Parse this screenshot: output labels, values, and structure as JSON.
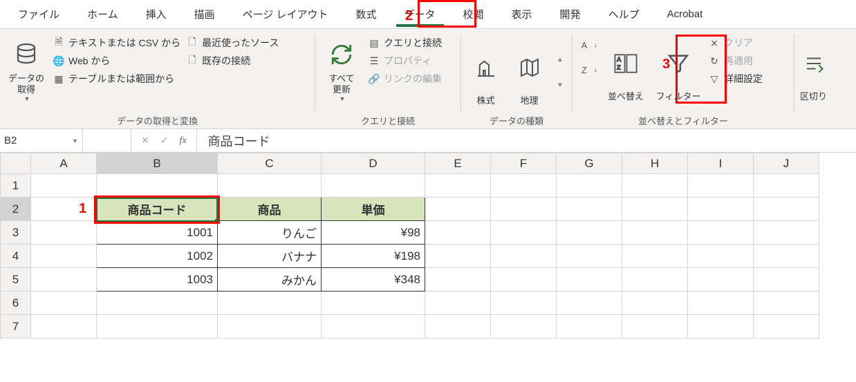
{
  "tabs": {
    "file": "ファイル",
    "home": "ホーム",
    "insert": "挿入",
    "draw": "描画",
    "pagelayout": "ページ レイアウト",
    "formulas": "数式",
    "data": "データ",
    "review": "校閲",
    "view": "表示",
    "developer": "開発",
    "help": "ヘルプ",
    "acrobat": "Acrobat"
  },
  "ribbon": {
    "group1": {
      "getdata": "データの\n取得",
      "from_csv": "テキストまたは CSV から",
      "from_web": "Web から",
      "from_table": "テーブルまたは範囲から",
      "recent": "最近使ったソース",
      "existing": "既存の接続",
      "label": "データの取得と変換"
    },
    "group2": {
      "refresh": "すべて\n更新",
      "queries": "クエリと接続",
      "properties": "プロパティ",
      "editlinks": "リンクの編集",
      "label": "クエリと接続"
    },
    "group3": {
      "stocks": "株式",
      "geo": "地理",
      "label": "データの種類"
    },
    "group4": {
      "sort": "並べ替え",
      "filter": "フィルター",
      "clear": "クリア",
      "reapply": "再適用",
      "advanced": "詳細設定",
      "label": "並べ替えとフィルター"
    },
    "group5": {
      "texttocol": "区切り"
    }
  },
  "fx": {
    "namebox": "B2",
    "formula": "商品コード"
  },
  "columns": [
    "A",
    "B",
    "C",
    "D",
    "E",
    "F",
    "G",
    "H",
    "I",
    "J"
  ],
  "rows": [
    "1",
    "2",
    "3",
    "4",
    "5",
    "6",
    "7"
  ],
  "table": {
    "headers": {
      "b": "商品コード",
      "c": "商品",
      "d": "単価"
    },
    "r3": {
      "b": "1001",
      "c": "りんご",
      "d": "¥98"
    },
    "r4": {
      "b": "1002",
      "c": "バナナ",
      "d": "¥198"
    },
    "r5": {
      "b": "1003",
      "c": "みかん",
      "d": "¥348"
    }
  },
  "annot": {
    "n1": "1",
    "n2": "2",
    "n3": "3"
  }
}
